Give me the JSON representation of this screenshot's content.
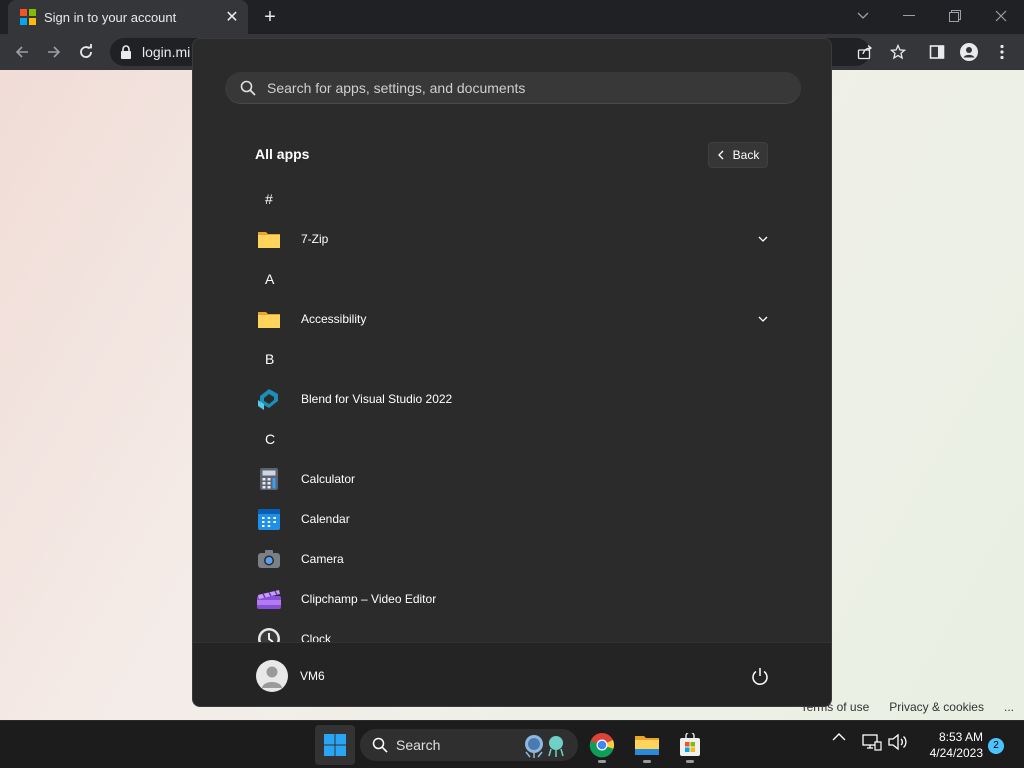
{
  "browser": {
    "tab_title": "Sign in to your account",
    "url": "login.mi",
    "icons": [
      "microsoft-logo",
      "close-icon",
      "plus-icon",
      "back-arrow-icon",
      "forward-arrow-icon",
      "reload-icon",
      "lock-icon",
      "share-icon",
      "star-icon",
      "sidebar-icon",
      "profile-icon",
      "more-icon"
    ]
  },
  "page": {
    "footer": {
      "terms": "Terms of use",
      "privacy": "Privacy & cookies",
      "more": "..."
    }
  },
  "start_menu": {
    "search_placeholder": "Search for apps, settings, and documents",
    "all_apps_title": "All apps",
    "back_label": "Back",
    "rows": [
      {
        "kind": "letter",
        "text": "#"
      },
      {
        "kind": "folder",
        "name": "7-Zip",
        "icon": "folder-icon",
        "expandable": true
      },
      {
        "kind": "letter",
        "text": "A"
      },
      {
        "kind": "folder",
        "name": "Accessibility",
        "icon": "folder-icon",
        "expandable": true
      },
      {
        "kind": "letter",
        "text": "B"
      },
      {
        "kind": "app",
        "name": "Blend for Visual Studio 2022",
        "icon": "blend-icon"
      },
      {
        "kind": "letter",
        "text": "C"
      },
      {
        "kind": "app",
        "name": "Calculator",
        "icon": "calculator-icon"
      },
      {
        "kind": "app",
        "name": "Calendar",
        "icon": "calendar-icon"
      },
      {
        "kind": "app",
        "name": "Camera",
        "icon": "camera-icon"
      },
      {
        "kind": "app",
        "name": "Clipchamp – Video Editor",
        "icon": "clipchamp-icon"
      },
      {
        "kind": "app",
        "name": "Clock",
        "icon": "clock-icon"
      }
    ],
    "user_name": "VM6"
  },
  "taskbar": {
    "search_label": "Search",
    "time": "8:53 AM",
    "date": "4/24/2023",
    "notification_count": "2",
    "colors": {
      "accent": "#4cc2ff",
      "start_blue": "#2aa4f4"
    }
  }
}
